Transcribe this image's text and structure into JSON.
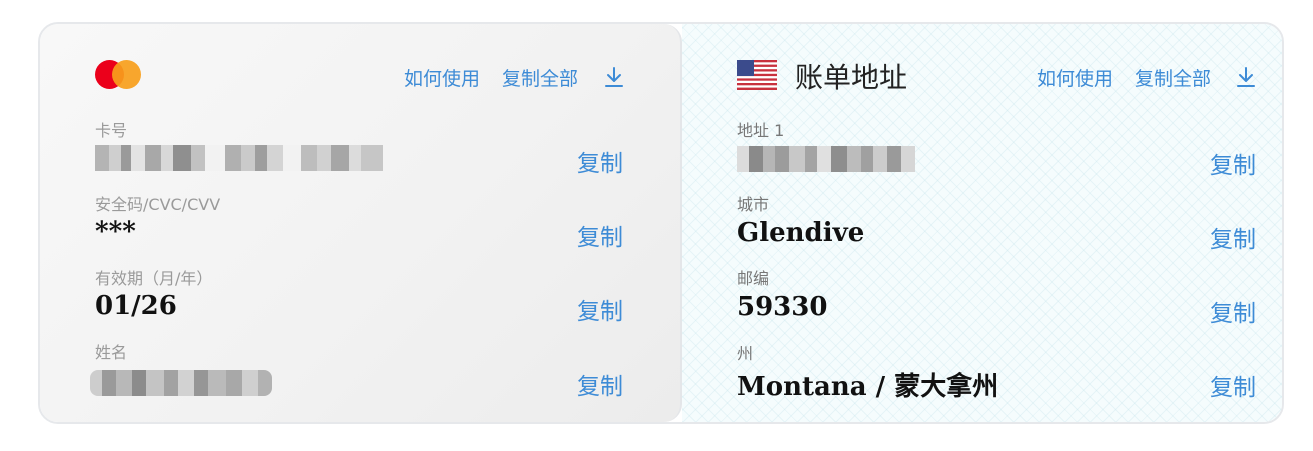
{
  "card": {
    "how_to_use": "如何使用",
    "copy_all": "复制全部",
    "download_icon": "download-icon",
    "brand_icon": "mastercard-logo-icon",
    "fields": {
      "card_number": {
        "label": "卡号",
        "copy_label": "复制"
      },
      "cvv": {
        "label": "安全码/CVC/CVV",
        "value": "***",
        "copy_label": "复制"
      },
      "expiry": {
        "label": "有效期（月/年）",
        "value": "01/26",
        "copy_label": "复制"
      },
      "name": {
        "label": "姓名",
        "copy_label": "复制"
      }
    }
  },
  "address": {
    "title": "账单地址",
    "flag_icon": "us-flag-icon",
    "how_to_use": "如何使用",
    "copy_all": "复制全部",
    "fields": {
      "address1": {
        "label": "地址 1",
        "copy_label": "复制"
      },
      "city": {
        "label": "城市",
        "value": "Glendive",
        "copy_label": "复制"
      },
      "zip": {
        "label": "邮编",
        "value": "59330",
        "copy_label": "复制"
      },
      "state": {
        "label": "州",
        "value": "Montana / 蒙大拿州",
        "copy_label": "复制"
      }
    }
  },
  "colors": {
    "accent": "#3d8bd6",
    "mastercard_red": "#eb001b",
    "mastercard_orange": "#f79e1b"
  }
}
